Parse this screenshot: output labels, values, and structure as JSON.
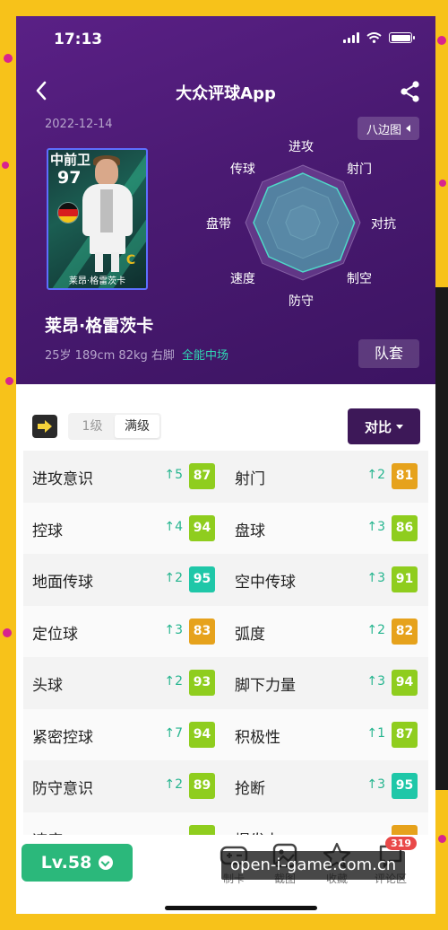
{
  "status": {
    "time": "17:13"
  },
  "nav": {
    "title": "大众评球App"
  },
  "player": {
    "date": "2022-12-14",
    "card_position": "中前卫",
    "card_rating": "97",
    "card_badge": "C",
    "card_name": "莱昂·格雷茨卡",
    "name": "莱昂·格雷茨卡",
    "meta": "25岁 189cm 82kg 右脚",
    "style": "全能中场",
    "kit_label": "队套"
  },
  "radar": {
    "toggle_label": "八边图",
    "axes": [
      "进攻",
      "射门",
      "对抗",
      "制空",
      "防守",
      "速度",
      "盘带",
      "传球"
    ],
    "values": [
      0.86,
      0.84,
      0.9,
      0.92,
      0.86,
      0.84,
      0.86,
      0.86
    ]
  },
  "toolbar": {
    "level_options": [
      "1级",
      "满级"
    ],
    "active_level": "满级",
    "compare_label": "对比"
  },
  "stats": [
    [
      {
        "name": "进攻意识",
        "inc": "5",
        "value": "87",
        "color": "#8fcd1e"
      },
      {
        "name": "射门",
        "inc": "2",
        "value": "81",
        "color": "#e6a21c"
      }
    ],
    [
      {
        "name": "控球",
        "inc": "4",
        "value": "94",
        "color": "#8fcd1e"
      },
      {
        "name": "盘球",
        "inc": "3",
        "value": "86",
        "color": "#8fcd1e"
      }
    ],
    [
      {
        "name": "地面传球",
        "inc": "2",
        "value": "95",
        "color": "#1fc7a8"
      },
      {
        "name": "空中传球",
        "inc": "3",
        "value": "91",
        "color": "#8fcd1e"
      }
    ],
    [
      {
        "name": "定位球",
        "inc": "3",
        "value": "83",
        "color": "#e6a21c"
      },
      {
        "name": "弧度",
        "inc": "2",
        "value": "82",
        "color": "#e6a21c"
      }
    ],
    [
      {
        "name": "头球",
        "inc": "2",
        "value": "93",
        "color": "#8fcd1e"
      },
      {
        "name": "脚下力量",
        "inc": "3",
        "value": "94",
        "color": "#8fcd1e"
      }
    ],
    [
      {
        "name": "紧密控球",
        "inc": "7",
        "value": "94",
        "color": "#8fcd1e"
      },
      {
        "name": "积极性",
        "inc": "1",
        "value": "87",
        "color": "#8fcd1e"
      }
    ],
    [
      {
        "name": "防守意识",
        "inc": "2",
        "value": "89",
        "color": "#8fcd1e"
      },
      {
        "name": "抢断",
        "inc": "3",
        "value": "95",
        "color": "#1fc7a8"
      }
    ],
    [
      {
        "name": "速度",
        "inc": "",
        "value": "",
        "color": "#8fcd1e"
      },
      {
        "name": "爆发力",
        "inc": "",
        "value": "",
        "color": "#e6a21c"
      }
    ]
  ],
  "bottom": {
    "level": "Lv.58",
    "tabs": [
      {
        "label": "制卡",
        "icon": "gamepad-icon"
      },
      {
        "label": "截图",
        "icon": "image-icon"
      },
      {
        "label": "收藏",
        "icon": "star-icon"
      },
      {
        "label": "评论区",
        "icon": "comment-icon"
      }
    ],
    "comment_count": "319"
  },
  "watermark": "open-i-game.com.cn"
}
